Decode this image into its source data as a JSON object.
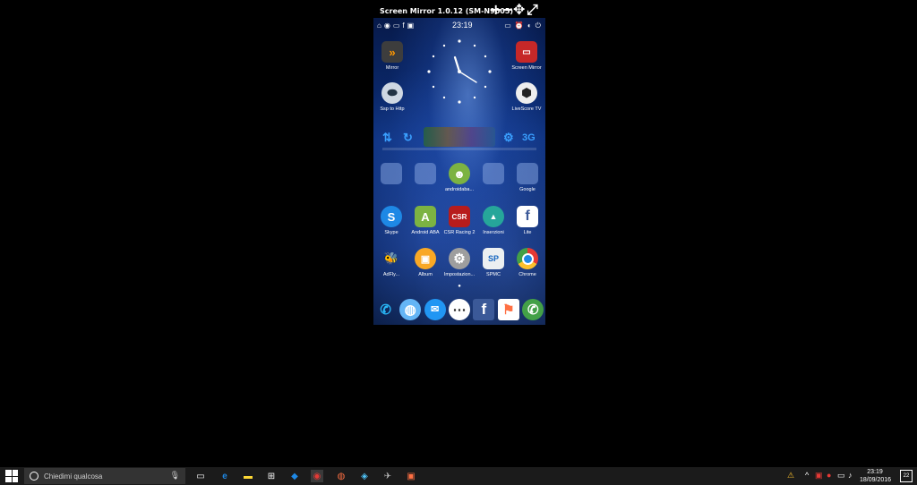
{
  "mirror_window": {
    "title": "Screen Mirror 1.0.12 (SM-N9005)",
    "controls": [
      "+",
      "−",
      "✥",
      "⤢"
    ]
  },
  "phone": {
    "status_time": "23:19",
    "network_label": "3G",
    "home_top_apps": [
      {
        "label": "Mirror",
        "icon": "mirror-icon",
        "color": "#444"
      },
      {
        "label": "Screen Mirror",
        "icon": "cast-icon",
        "color": "#c62828"
      },
      {
        "label": "Ssp to Http",
        "icon": "sphere-icon",
        "color": "#cfd8e3"
      },
      {
        "label": "LiveScore TV",
        "icon": "soccer-ball-icon",
        "color": "#e8e8e8"
      }
    ],
    "row1": [
      {
        "label": "",
        "icon": "folder-icon"
      },
      {
        "label": "",
        "icon": "folder-icon"
      },
      {
        "label": "androidaba...",
        "icon": "android-icon"
      },
      {
        "label": "",
        "icon": "folder-icon"
      },
      {
        "label": "Google",
        "icon": "folder-icon"
      }
    ],
    "row2": [
      {
        "label": "Skype",
        "icon": "skype-icon",
        "glyph": "S",
        "color": "#1e88e5"
      },
      {
        "label": "Android ABA",
        "icon": "android-aba-icon",
        "glyph": "A",
        "color": "#7cb342"
      },
      {
        "label": "CSR Racing 2",
        "icon": "csr-racing-icon",
        "glyph": "CSR",
        "color": "#b71c1c"
      },
      {
        "label": "Inserzioni",
        "icon": "inserzioni-icon",
        "glyph": "▲",
        "color": "#26a69a"
      },
      {
        "label": "Lite",
        "icon": "facebook-lite-icon",
        "glyph": "f",
        "color": "#ffffff"
      }
    ],
    "row3": [
      {
        "label": "AdFly...",
        "icon": "bee-icon",
        "glyph": "🐝",
        "color": "#fbc02d"
      },
      {
        "label": "Album",
        "icon": "album-icon",
        "glyph": "▣",
        "color": "#f9a825"
      },
      {
        "label": "Impostazion...",
        "icon": "settings-icon",
        "glyph": "⚙",
        "color": "#9e9e9e"
      },
      {
        "label": "SPMC",
        "icon": "spmc-icon",
        "glyph": "SP",
        "color": "#eceff1"
      },
      {
        "label": "Chrome",
        "icon": "chrome-icon",
        "glyph": "◉",
        "color": "#e53935"
      }
    ],
    "dock": [
      {
        "icon": "phone-icon",
        "glyph": "✆",
        "color": "#29b6f6"
      },
      {
        "icon": "internet-icon",
        "glyph": "◍",
        "color": "#64b5f6"
      },
      {
        "icon": "messenger-icon",
        "glyph": "✉",
        "color": "#2196f3"
      },
      {
        "icon": "apps-icon",
        "glyph": "⋯",
        "color": "#ffffff"
      },
      {
        "icon": "facebook-icon",
        "glyph": "f",
        "color": "#3b5998"
      },
      {
        "icon": "flag-icon",
        "glyph": "⚑",
        "color": "#ff7043"
      },
      {
        "icon": "whatsapp-icon",
        "glyph": "✆",
        "color": "#43a047"
      }
    ]
  },
  "taskbar": {
    "search_placeholder": "Chiedimi qualcosa",
    "time": "23:19",
    "date": "18/09/2016",
    "notifications": "22"
  }
}
